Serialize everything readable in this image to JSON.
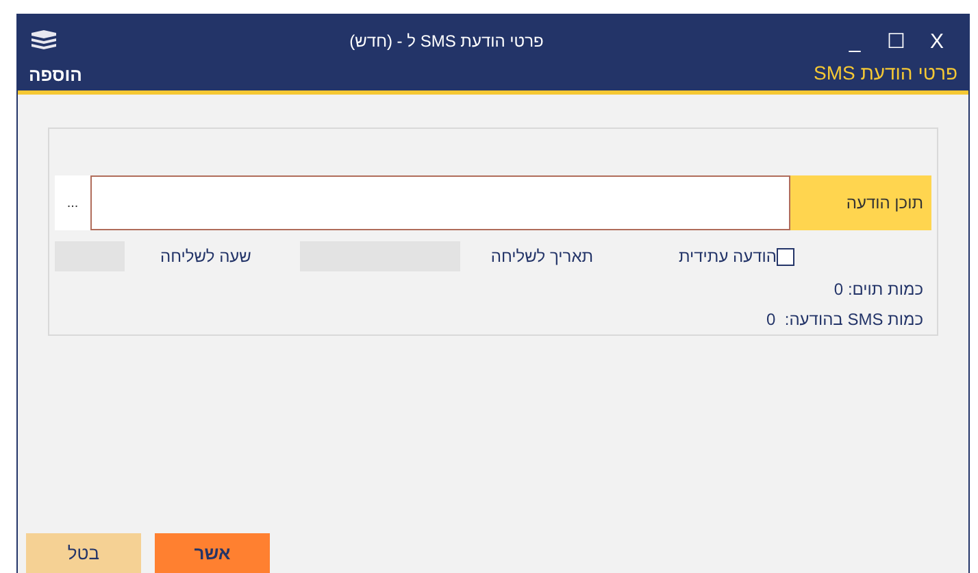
{
  "window": {
    "title": "פרטי הודעת SMS ל - (חדש)",
    "controls": [
      "X",
      "☐",
      "_"
    ]
  },
  "header": {
    "title": "פרטי הודעת SMS",
    "mode": "הוספה"
  },
  "message": {
    "label": "תוכן הודעה",
    "more": "..."
  },
  "future": {
    "label": "הודעה עתידית",
    "checked": false
  },
  "send_date": {
    "label": "תאריך לשליחה",
    "disabled": true
  },
  "send_time": {
    "label": "שעה לשליחה",
    "disabled": true
  },
  "counts": [
    "כמות תוים: 0",
    "כמות SMS בהודעה:  0"
  ],
  "buttons": [
    {
      "label": "אשר",
      "kind": "primary"
    },
    {
      "label": "בטל",
      "kind": "secondary"
    }
  ]
}
